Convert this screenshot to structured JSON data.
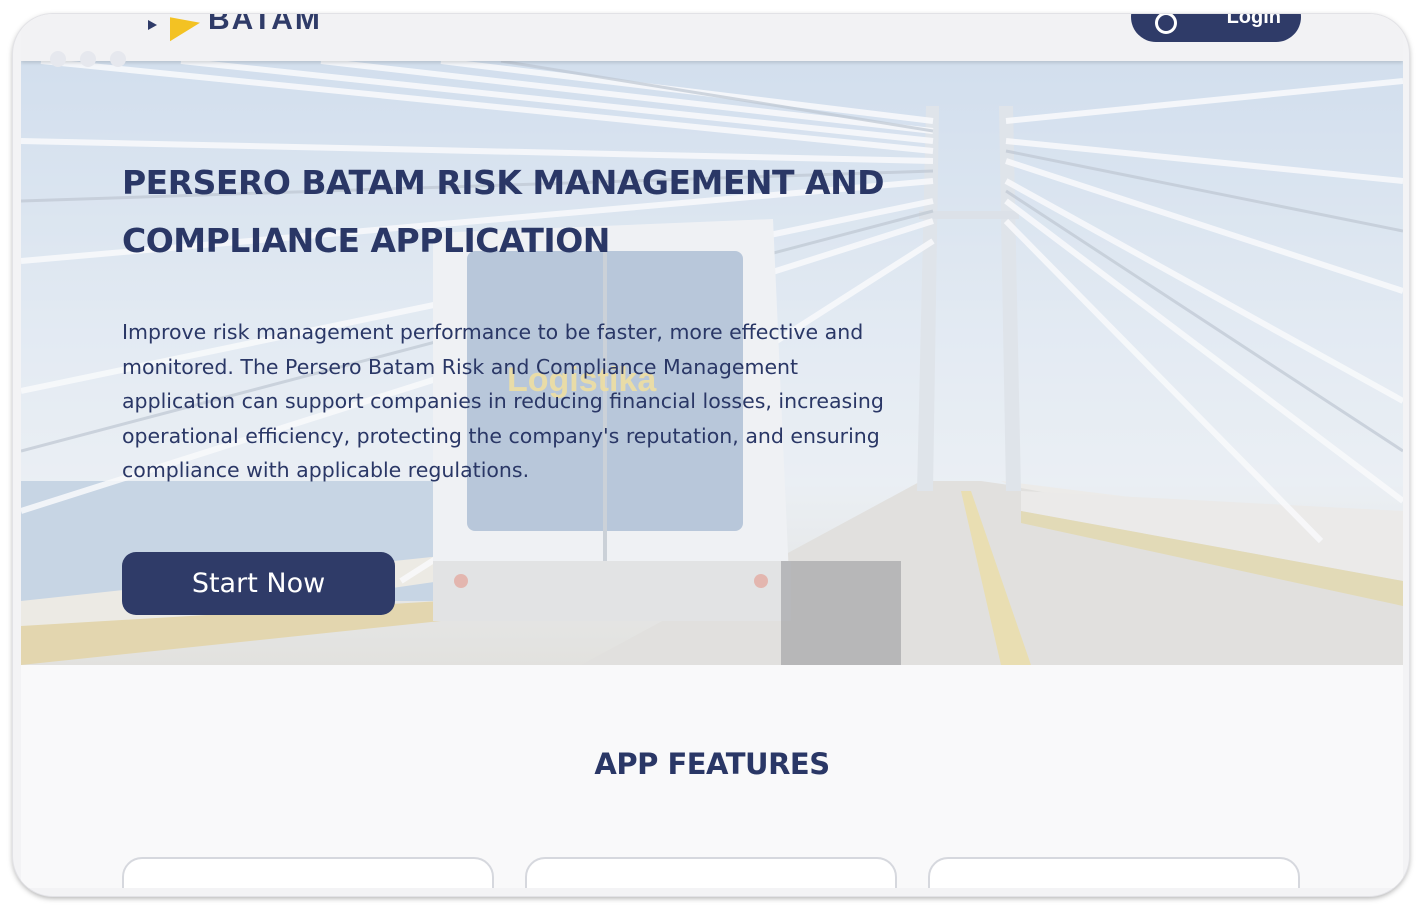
{
  "brand": {
    "logo_text": "BATAM",
    "accent": "#f3c223",
    "primary": "#2f3b68",
    "text": "#2a3766"
  },
  "header": {
    "account_button_label": "Login",
    "account_icon": "user-icon"
  },
  "hero": {
    "title": "PERSERO BATAM RISK MANAGEMENT AND COMPLIANCE APPLICATION",
    "description": "Improve risk management performance to be faster, more effective and monitored. The Persero Batam Risk and Compliance Management application can support companies in reducing financial losses, increasing operational efficiency, protecting the company's reputation, and ensuring compliance with applicable regulations.",
    "cta_label": "Start Now",
    "truck_text": "Logistika"
  },
  "features": {
    "title": "APP FEATURES",
    "cards": [
      {},
      {},
      {}
    ]
  }
}
